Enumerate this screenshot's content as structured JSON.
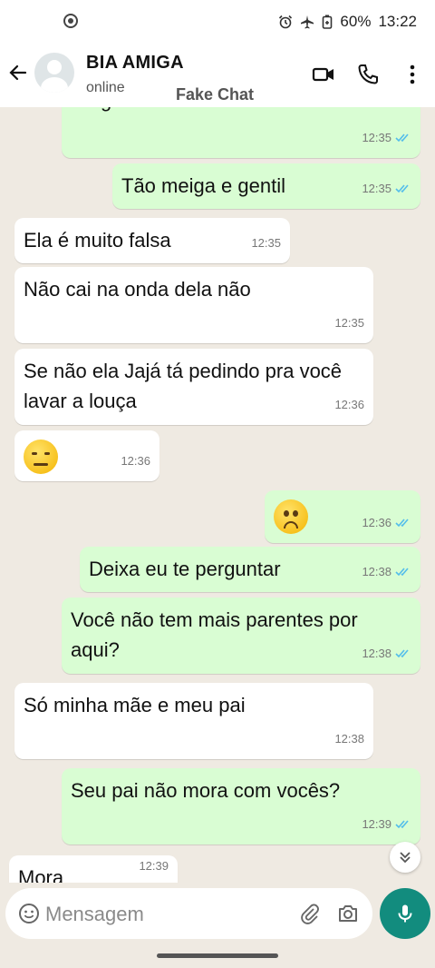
{
  "status_bar": {
    "battery": "60%",
    "time": "13:22"
  },
  "header": {
    "contact_name": "BIA AMIGA",
    "contact_status": "online",
    "watermark": "Fake Chat"
  },
  "messages": [
    {
      "dir": "out",
      "text": "Eu gostei de conhecer ela",
      "time": "12:35",
      "read": true
    },
    {
      "dir": "out",
      "text": "Tão meiga e gentil",
      "time": "12:35",
      "read": true
    },
    {
      "dir": "in",
      "text": "Ela é muito falsa",
      "time": "12:35"
    },
    {
      "dir": "in",
      "text": "Não cai na onda dela não",
      "time": "12:35"
    },
    {
      "dir": "in",
      "text": "Se não ela Jajá tá pedindo pra você lavar a louça",
      "time": "12:36"
    },
    {
      "dir": "in",
      "emoji": "unamused-face",
      "time": "12:36"
    },
    {
      "dir": "out",
      "emoji": "slightly-frowning-face",
      "time": "12:36",
      "read": true
    },
    {
      "dir": "out",
      "text": "Deixa eu te perguntar",
      "time": "12:38",
      "read": true
    },
    {
      "dir": "out",
      "text": "Você não tem mais parentes por aqui?",
      "time": "12:38",
      "read": true
    },
    {
      "dir": "in",
      "text": "Só minha mãe e meu pai",
      "time": "12:38"
    },
    {
      "dir": "out",
      "text": "Seu pai não mora com vocês?",
      "time": "12:39",
      "read": true
    },
    {
      "dir": "in",
      "text": "Mora",
      "time": "12:39"
    }
  ],
  "composer": {
    "placeholder": "Mensagem"
  },
  "colors": {
    "chat_background": "#efeae2",
    "outgoing_bubble": "#d9fdd3",
    "incoming_bubble": "#ffffff",
    "read_ticks": "#53bdeb",
    "mic_button": "#128c7e"
  }
}
